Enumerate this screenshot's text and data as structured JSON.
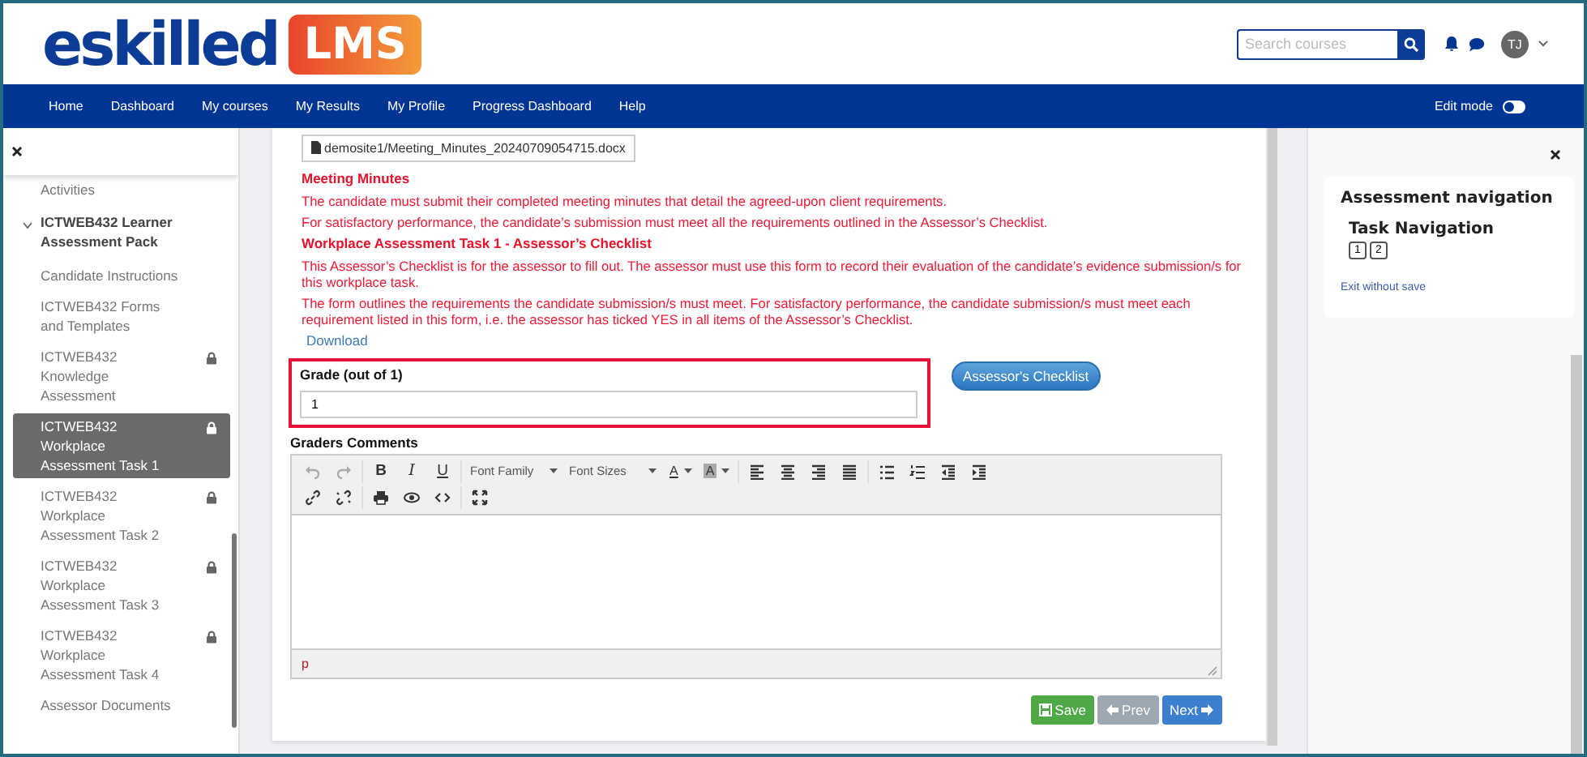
{
  "header": {
    "logo": {
      "brand": "eskilled",
      "product": "LMS"
    },
    "search": {
      "placeholder": "Search courses"
    },
    "avatar": "TJ"
  },
  "nav": {
    "items": [
      "Home",
      "Dashboard",
      "My courses",
      "My Results",
      "My Profile",
      "Progress Dashboard",
      "Help"
    ],
    "edit_mode": {
      "label": "Edit mode",
      "on": false
    }
  },
  "sidebar": {
    "items": [
      {
        "label": "Activities",
        "locked": false,
        "selected": false
      },
      {
        "label": "ICTWEB432 Learner Assessment Pack",
        "expanded": true,
        "children": [
          {
            "label": "Candidate Instructions",
            "locked": false,
            "selected": false
          },
          {
            "label": "ICTWEB432 Forms and Templates",
            "locked": false,
            "selected": false
          },
          {
            "label": "ICTWEB432 Knowledge Assessment",
            "locked": true,
            "selected": false
          },
          {
            "label": "ICTWEB432 Workplace Assessment Task 1",
            "locked": true,
            "selected": true
          },
          {
            "label": "ICTWEB432 Workplace Assessment Task 2",
            "locked": true,
            "selected": false
          },
          {
            "label": "ICTWEB432 Workplace Assessment Task 3",
            "locked": true,
            "selected": false
          },
          {
            "label": "ICTWEB432 Workplace Assessment Task 4",
            "locked": true,
            "selected": false
          },
          {
            "label": "Assessor Documents",
            "locked": false,
            "selected": false
          }
        ]
      }
    ]
  },
  "content": {
    "file": "demosite1/Meeting_Minutes_20240709054715.docx",
    "blocks": [
      {
        "kind": "heading",
        "text": "Meeting Minutes"
      },
      {
        "kind": "para",
        "text": "The candidate must submit their completed meeting minutes that detail the agreed-upon client requirements."
      },
      {
        "kind": "para",
        "text": "For satisfactory performance, the candidate’s submission must meet all the requirements outlined in the Assessor’s Checklist."
      },
      {
        "kind": "heading",
        "text": "Workplace Assessment Task 1 - Assessor’s Checklist"
      },
      {
        "kind": "para",
        "text": "This Assessor’s Checklist is for the assessor to fill out. The assessor must use this form to record their evaluation of the candidate’s evidence submission/s for this workplace task."
      },
      {
        "kind": "para",
        "text": "The form outlines the requirements the candidate submission/s must meet. For satisfactory performance, the candidate submission/s must meet each requirement listed in this form, i.e. the assessor has ticked YES in all items of the Assessor’s Checklist."
      }
    ],
    "download": "Download",
    "grade": {
      "label": "Grade (out of 1)",
      "value": "1"
    },
    "checklist_button": "Assessor's Checklist",
    "comments": {
      "label": "Graders Comments",
      "path": "p",
      "toolbar": [
        [
          [
            {
              "kind": "undo",
              "disabled": true
            },
            {
              "kind": "redo",
              "disabled": true
            }
          ],
          [
            {
              "kind": "bold",
              "text": "B"
            },
            {
              "kind": "italic",
              "text": "I"
            },
            {
              "kind": "underline",
              "text": "U"
            }
          ],
          [
            {
              "kind": "dropdown",
              "text": "Font Family"
            },
            {
              "kind": "dropdown",
              "text": "Font Sizes"
            },
            {
              "kind": "color",
              "text": "A"
            },
            {
              "kind": "color",
              "text": "A",
              "shaded": true
            }
          ],
          [
            {
              "kind": "align-left"
            },
            {
              "kind": "align-center"
            },
            {
              "kind": "align-right"
            },
            {
              "kind": "justify"
            }
          ],
          [
            {
              "kind": "bullets"
            },
            {
              "kind": "numbers"
            },
            {
              "kind": "outdent"
            },
            {
              "kind": "indent"
            }
          ]
        ],
        [
          [
            {
              "kind": "link"
            },
            {
              "kind": "unlink"
            }
          ],
          [
            {
              "kind": "print"
            },
            {
              "kind": "preview"
            },
            {
              "kind": "code"
            }
          ],
          [
            {
              "kind": "fullscreen"
            }
          ]
        ]
      ]
    },
    "buttons": [
      {
        "kind": "save",
        "label": "Save",
        "disabled": false
      },
      {
        "kind": "prev",
        "label": "Prev",
        "disabled": true
      },
      {
        "kind": "next",
        "label": "Next",
        "disabled": false
      }
    ]
  },
  "drawer": {
    "title": "Assessment navigation",
    "subtitle": "Task Navigation",
    "tasks": [
      "1",
      "2"
    ],
    "exit": "Exit without save"
  }
}
